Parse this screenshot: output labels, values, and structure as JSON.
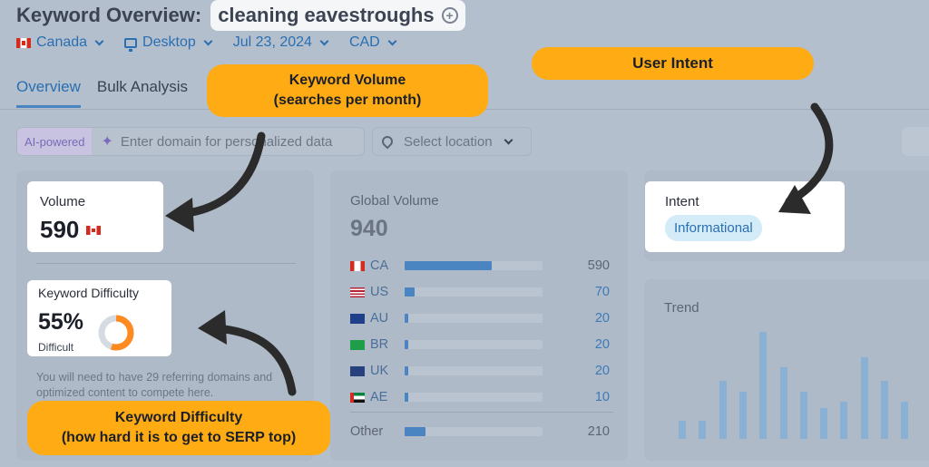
{
  "header": {
    "title_prefix": "Keyword Overview:",
    "keyword": "cleaning eavestroughs"
  },
  "filters": {
    "country": "Canada",
    "device": "Desktop",
    "date": "Jul 23, 2024",
    "currency": "CAD"
  },
  "tabs": [
    {
      "label": "Overview",
      "active": true
    },
    {
      "label": "Bulk Analysis",
      "active": false
    }
  ],
  "toolbar": {
    "ai_label": "AI-powered",
    "domain_placeholder": "Enter domain for personalized data",
    "location_placeholder": "Select location"
  },
  "volume": {
    "label": "Volume",
    "value": "590"
  },
  "keyword_difficulty": {
    "label": "Keyword Difficulty",
    "value": "55%",
    "percent": 55,
    "level": "Difficult",
    "note": "You will need to have 29 referring domains and optimized content to compete here."
  },
  "global_volume": {
    "label": "Global Volume",
    "value": "940",
    "countries": [
      {
        "code": "CA",
        "value": "590",
        "fraction": 0.63
      },
      {
        "code": "US",
        "value": "70",
        "fraction": 0.07
      },
      {
        "code": "AU",
        "value": "20",
        "fraction": 0.02
      },
      {
        "code": "BR",
        "value": "20",
        "fraction": 0.02
      },
      {
        "code": "UK",
        "value": "20",
        "fraction": 0.02
      },
      {
        "code": "AE",
        "value": "10",
        "fraction": 0.01
      }
    ],
    "other": {
      "label": "Other",
      "value": "210",
      "fraction": 0.22
    }
  },
  "intent": {
    "label": "Intent",
    "badge": "Informational"
  },
  "trend": {
    "label": "Trend",
    "values": [
      0.17,
      0.17,
      0.54,
      0.44,
      1.0,
      0.67,
      0.44,
      0.29,
      0.35,
      0.76,
      0.54,
      0.35
    ]
  },
  "annotations": {
    "volume_line1": "Keyword Volume",
    "volume_line2": "(searches per month)",
    "intent": "User Intent",
    "kd_line1": "Keyword Difficulty",
    "kd_line2": "(how hard it is to get to SERP top)"
  },
  "colors": {
    "accent": "#ffab14",
    "bar": "#4a85c2",
    "kd_orange": "#ff8a1f"
  }
}
